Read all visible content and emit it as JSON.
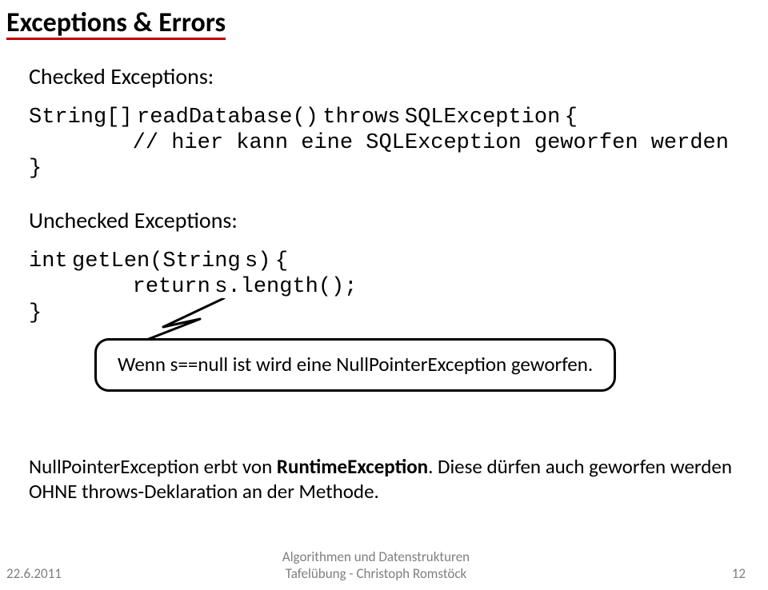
{
  "title": "Exceptions & Errors",
  "section1_label": "Checked Exceptions:",
  "code1": "String[] readDatabase() throws SQLException {\n        // hier kann eine SQLException geworfen werden\n}",
  "section2_label": "Unchecked Exceptions:",
  "code2": "int getLen(String s) {\n        return s.length();\n}",
  "callout": "Wenn s==null ist wird eine NullPointerException geworfen.",
  "para_pre": "NullPointerException erbt von ",
  "para_bold": "RuntimeException",
  "para_post": ". Diese dürfen auch geworfen werden OHNE throws-Deklaration an der Methode.",
  "footer": {
    "date": "22.6.2011",
    "line1": "Algorithmen und Datenstrukturen",
    "line2": "Tafelübung - Christoph Romstöck",
    "page": "12"
  }
}
